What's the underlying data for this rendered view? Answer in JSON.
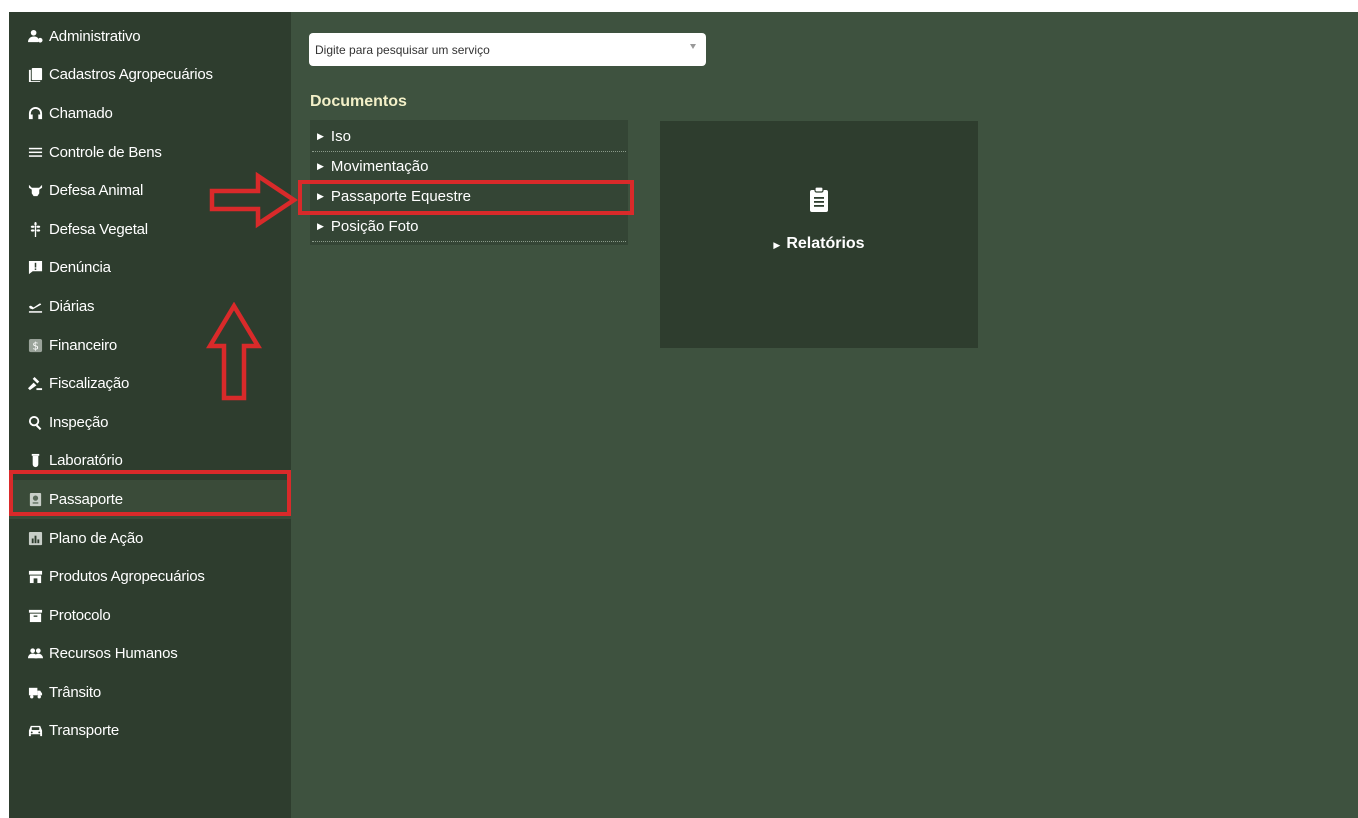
{
  "sidebar": {
    "items": [
      {
        "label": "Administrativo",
        "icon": "user-gear-icon"
      },
      {
        "label": "Cadastros Agropecuários",
        "icon": "document-list-icon"
      },
      {
        "label": "Chamado",
        "icon": "headset-icon"
      },
      {
        "label": "Controle de Bens",
        "icon": "list-icon"
      },
      {
        "label": "Defesa Animal",
        "icon": "bull-icon"
      },
      {
        "label": "Defesa Vegetal",
        "icon": "wheat-icon"
      },
      {
        "label": "Denúncia",
        "icon": "alert-message-icon"
      },
      {
        "label": "Diárias",
        "icon": "plane-departure-icon"
      },
      {
        "label": "Financeiro",
        "icon": "dollar-icon"
      },
      {
        "label": "Fiscalização",
        "icon": "gavel-icon"
      },
      {
        "label": "Inspeção",
        "icon": "search-icon"
      },
      {
        "label": "Laboratório",
        "icon": "flask-icon"
      },
      {
        "label": "Passaporte",
        "icon": "passport-icon"
      },
      {
        "label": "Plano de Ação",
        "icon": "chart-icon"
      },
      {
        "label": "Produtos Agropecuários",
        "icon": "store-icon"
      },
      {
        "label": "Protocolo",
        "icon": "archive-icon"
      },
      {
        "label": "Recursos Humanos",
        "icon": "users-icon"
      },
      {
        "label": "Trânsito",
        "icon": "truck-icon"
      },
      {
        "label": "Transporte",
        "icon": "car-icon"
      }
    ],
    "active_item": "Passaporte"
  },
  "search": {
    "placeholder": "Digite para pesquisar um serviço"
  },
  "documents": {
    "title": "Documentos",
    "items": [
      "Iso",
      "Movimentação",
      "Passaporte Equestre",
      "Posição Foto"
    ]
  },
  "reports": {
    "label": "Relatórios",
    "icon": "clipboard-icon"
  },
  "annotation_color": "#d92a2a"
}
